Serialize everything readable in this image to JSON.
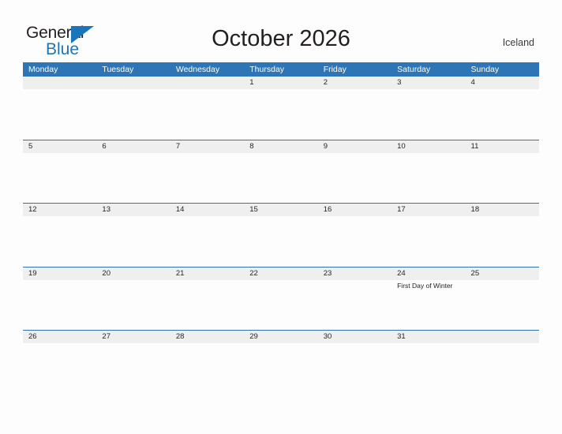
{
  "brand": {
    "name_part1": "General",
    "name_part2": "Blue",
    "triangle_color": "#1b75bb"
  },
  "header": {
    "title": "October 2026",
    "region": "Iceland"
  },
  "theme": {
    "header_blue": "#2e75b6",
    "date_band_gray": "#efefef",
    "page_background": "#fdfdfd",
    "text_dark": "#231f20"
  },
  "calendar": {
    "month": "October",
    "year": "2026",
    "weekdays": [
      "Monday",
      "Tuesday",
      "Wednesday",
      "Thursday",
      "Friday",
      "Saturday",
      "Sunday"
    ],
    "weeks": [
      {
        "days": [
          {
            "date": "",
            "events": []
          },
          {
            "date": "",
            "events": []
          },
          {
            "date": "",
            "events": []
          },
          {
            "date": "1",
            "events": []
          },
          {
            "date": "2",
            "events": []
          },
          {
            "date": "3",
            "events": []
          },
          {
            "date": "4",
            "events": []
          }
        ]
      },
      {
        "days": [
          {
            "date": "5",
            "events": []
          },
          {
            "date": "6",
            "events": []
          },
          {
            "date": "7",
            "events": []
          },
          {
            "date": "8",
            "events": []
          },
          {
            "date": "9",
            "events": []
          },
          {
            "date": "10",
            "events": []
          },
          {
            "date": "11",
            "events": []
          }
        ]
      },
      {
        "days": [
          {
            "date": "12",
            "events": []
          },
          {
            "date": "13",
            "events": []
          },
          {
            "date": "14",
            "events": []
          },
          {
            "date": "15",
            "events": []
          },
          {
            "date": "16",
            "events": []
          },
          {
            "date": "17",
            "events": []
          },
          {
            "date": "18",
            "events": []
          }
        ]
      },
      {
        "days": [
          {
            "date": "19",
            "events": []
          },
          {
            "date": "20",
            "events": []
          },
          {
            "date": "21",
            "events": []
          },
          {
            "date": "22",
            "events": []
          },
          {
            "date": "23",
            "events": []
          },
          {
            "date": "24",
            "events": [
              "First Day of Winter"
            ]
          },
          {
            "date": "25",
            "events": []
          }
        ]
      },
      {
        "days": [
          {
            "date": "26",
            "events": []
          },
          {
            "date": "27",
            "events": []
          },
          {
            "date": "28",
            "events": []
          },
          {
            "date": "29",
            "events": []
          },
          {
            "date": "30",
            "events": []
          },
          {
            "date": "31",
            "events": []
          },
          {
            "date": "",
            "events": []
          }
        ]
      }
    ]
  }
}
